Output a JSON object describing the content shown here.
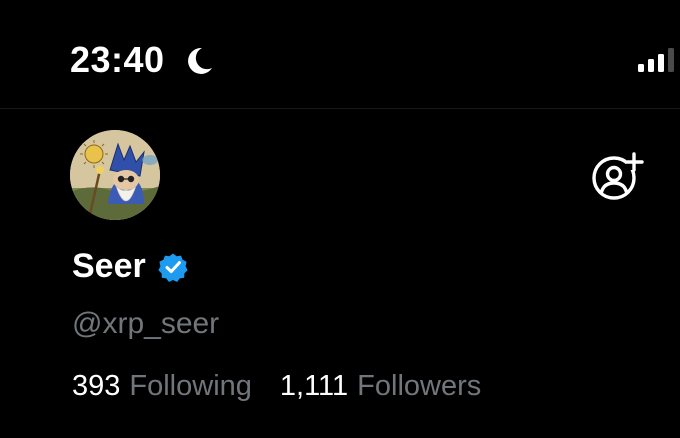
{
  "status_bar": {
    "time": "23:40",
    "focus_icon": "moon-icon",
    "signal_icon": "cellular-signal-icon"
  },
  "profile": {
    "display_name": "Seer",
    "verified": true,
    "verified_badge_icon": "verified-badge-icon",
    "handle": "@xrp_seer",
    "avatar": "wizard-avatar-image",
    "follow_action_icon": "add-user-icon"
  },
  "stats": {
    "following_count": "393",
    "following_label": "Following",
    "followers_count": "1,111",
    "followers_label": "Followers"
  },
  "colors": {
    "background": "#000000",
    "primary_text": "#ffffff",
    "secondary_text": "#71767b",
    "verified_blue": "#1d9bf0"
  }
}
